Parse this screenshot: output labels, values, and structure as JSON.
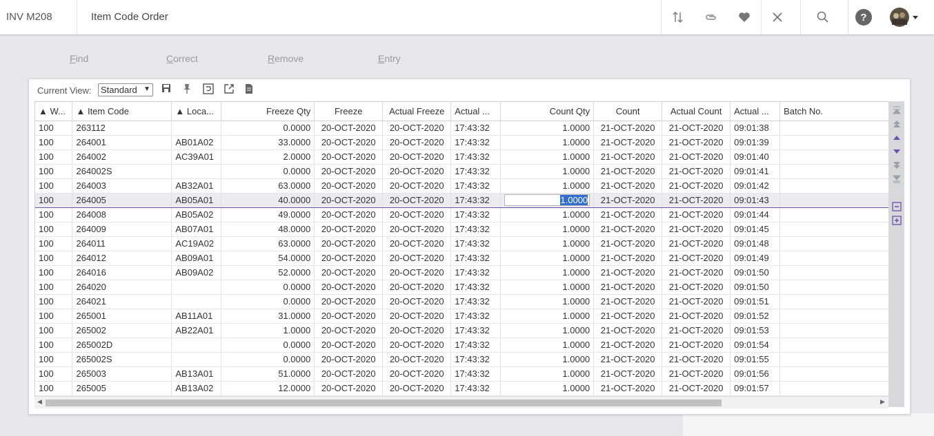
{
  "app": {
    "code": "INV M208",
    "title": "Item Code Order"
  },
  "topbar_icons": [
    "sort-arrows-icon",
    "attachment-icon",
    "favorite-heart-icon",
    "close-icon",
    "search-icon",
    "help-icon",
    "avatar"
  ],
  "actions": [
    {
      "ul": "F",
      "rest": "ind"
    },
    {
      "ul": "C",
      "rest": "orrect"
    },
    {
      "ul": "R",
      "rest": "emove"
    },
    {
      "ul": "E",
      "rest": "ntry"
    }
  ],
  "view": {
    "label": "Current View:",
    "selected": "Standard"
  },
  "columns": [
    "▲ W...",
    "▲ Item Code",
    "▲ Loca...",
    "Freeze Qty",
    "Freeze",
    "Actual Freeze",
    "Actual ...",
    "Count Qty",
    "Count",
    "Actual Count",
    "Actual ...",
    "Batch No."
  ],
  "rows": [
    [
      "100",
      "263112",
      "",
      "0.0000",
      "20-OCT-2020",
      "20-OCT-2020",
      "17:43:32",
      "1.0000",
      "21-OCT-2020",
      "21-OCT-2020",
      "09:01:38",
      ""
    ],
    [
      "100",
      "264001",
      "AB01A02",
      "33.0000",
      "20-OCT-2020",
      "20-OCT-2020",
      "17:43:32",
      "1.0000",
      "21-OCT-2020",
      "21-OCT-2020",
      "09:01:39",
      ""
    ],
    [
      "100",
      "264002",
      "AC39A01",
      "2.0000",
      "20-OCT-2020",
      "20-OCT-2020",
      "17:43:32",
      "1.0000",
      "21-OCT-2020",
      "21-OCT-2020",
      "09:01:40",
      ""
    ],
    [
      "100",
      "264002S",
      "",
      "0.0000",
      "20-OCT-2020",
      "20-OCT-2020",
      "17:43:32",
      "1.0000",
      "21-OCT-2020",
      "21-OCT-2020",
      "09:01:41",
      ""
    ],
    [
      "100",
      "264003",
      "AB32A01",
      "63.0000",
      "20-OCT-2020",
      "20-OCT-2020",
      "17:43:32",
      "1.0000",
      "21-OCT-2020",
      "21-OCT-2020",
      "09:01:42",
      ""
    ],
    [
      "100",
      "264005",
      "AB05A01",
      "40.0000",
      "20-OCT-2020",
      "20-OCT-2020",
      "17:43:32",
      "1.0000",
      "21-OCT-2020",
      "21-OCT-2020",
      "09:01:43",
      ""
    ],
    [
      "100",
      "264008",
      "AB05A02",
      "49.0000",
      "20-OCT-2020",
      "20-OCT-2020",
      "17:43:32",
      "1.0000",
      "21-OCT-2020",
      "21-OCT-2020",
      "09:01:44",
      ""
    ],
    [
      "100",
      "264009",
      "AB07A01",
      "48.0000",
      "20-OCT-2020",
      "20-OCT-2020",
      "17:43:32",
      "1.0000",
      "21-OCT-2020",
      "21-OCT-2020",
      "09:01:45",
      ""
    ],
    [
      "100",
      "264011",
      "AC19A02",
      "63.0000",
      "20-OCT-2020",
      "20-OCT-2020",
      "17:43:32",
      "1.0000",
      "21-OCT-2020",
      "21-OCT-2020",
      "09:01:48",
      ""
    ],
    [
      "100",
      "264012",
      "AB09A01",
      "54.0000",
      "20-OCT-2020",
      "20-OCT-2020",
      "17:43:32",
      "1.0000",
      "21-OCT-2020",
      "21-OCT-2020",
      "09:01:49",
      ""
    ],
    [
      "100",
      "264016",
      "AB09A02",
      "52.0000",
      "20-OCT-2020",
      "20-OCT-2020",
      "17:43:32",
      "1.0000",
      "21-OCT-2020",
      "21-OCT-2020",
      "09:01:50",
      ""
    ],
    [
      "100",
      "264020",
      "",
      "0.0000",
      "20-OCT-2020",
      "20-OCT-2020",
      "17:43:32",
      "1.0000",
      "21-OCT-2020",
      "21-OCT-2020",
      "09:01:50",
      ""
    ],
    [
      "100",
      "264021",
      "",
      "0.0000",
      "20-OCT-2020",
      "20-OCT-2020",
      "17:43:32",
      "1.0000",
      "21-OCT-2020",
      "21-OCT-2020",
      "09:01:51",
      ""
    ],
    [
      "100",
      "265001",
      "AB11A01",
      "31.0000",
      "20-OCT-2020",
      "20-OCT-2020",
      "17:43:32",
      "1.0000",
      "21-OCT-2020",
      "21-OCT-2020",
      "09:01:52",
      ""
    ],
    [
      "100",
      "265002",
      "AB22A01",
      "1.0000",
      "20-OCT-2020",
      "20-OCT-2020",
      "17:43:32",
      "1.0000",
      "21-OCT-2020",
      "21-OCT-2020",
      "09:01:53",
      ""
    ],
    [
      "100",
      "265002D",
      "",
      "0.0000",
      "20-OCT-2020",
      "20-OCT-2020",
      "17:43:32",
      "1.0000",
      "21-OCT-2020",
      "21-OCT-2020",
      "09:01:54",
      ""
    ],
    [
      "100",
      "265002S",
      "",
      "0.0000",
      "20-OCT-2020",
      "20-OCT-2020",
      "17:43:32",
      "1.0000",
      "21-OCT-2020",
      "21-OCT-2020",
      "09:01:55",
      ""
    ],
    [
      "100",
      "265003",
      "AB13A01",
      "51.0000",
      "20-OCT-2020",
      "20-OCT-2020",
      "17:43:32",
      "1.0000",
      "21-OCT-2020",
      "21-OCT-2020",
      "09:01:56",
      ""
    ],
    [
      "100",
      "265005",
      "AB13A02",
      "12.0000",
      "20-OCT-2020",
      "20-OCT-2020",
      "17:43:32",
      "1.0000",
      "21-OCT-2020",
      "21-OCT-2020",
      "09:01:57",
      ""
    ]
  ],
  "selected_row": 5,
  "colors": {
    "accent": "#6a4fb3",
    "highlight": "#2f6fd0"
  }
}
